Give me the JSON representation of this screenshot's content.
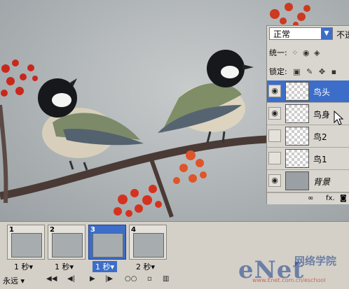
{
  "layers_panel": {
    "blend_mode": "正常",
    "opacity_label": "不透",
    "unify_label": "统一:",
    "lock_label": "锁定:",
    "layers": [
      {
        "name": "鸟头",
        "visible": true,
        "selected": true,
        "italic": false
      },
      {
        "name": "鸟身",
        "visible": true,
        "selected": false,
        "italic": false
      },
      {
        "name": "鸟2",
        "visible": false,
        "selected": false,
        "italic": false
      },
      {
        "name": "鸟1",
        "visible": false,
        "selected": false,
        "italic": false
      },
      {
        "name": "背景",
        "visible": true,
        "selected": false,
        "italic": true
      }
    ],
    "footer_fx": "fx."
  },
  "animation_panel": {
    "frames": [
      {
        "number": "1",
        "delay": "1 秒▾",
        "selected": false
      },
      {
        "number": "2",
        "delay": "1 秒▾",
        "selected": false
      },
      {
        "number": "3",
        "delay": "1 秒▾",
        "selected": true
      },
      {
        "number": "4",
        "delay": "2 秒▾",
        "selected": false
      }
    ],
    "loop_label": "永远 ▾"
  },
  "watermark": {
    "brand": "eNet",
    "brand_cn": "网络学院",
    "url": "www.Enet.com.cn/eschool"
  },
  "colors": {
    "selected": "#3c6ec9",
    "panel_bg": "#d4d0c8"
  }
}
